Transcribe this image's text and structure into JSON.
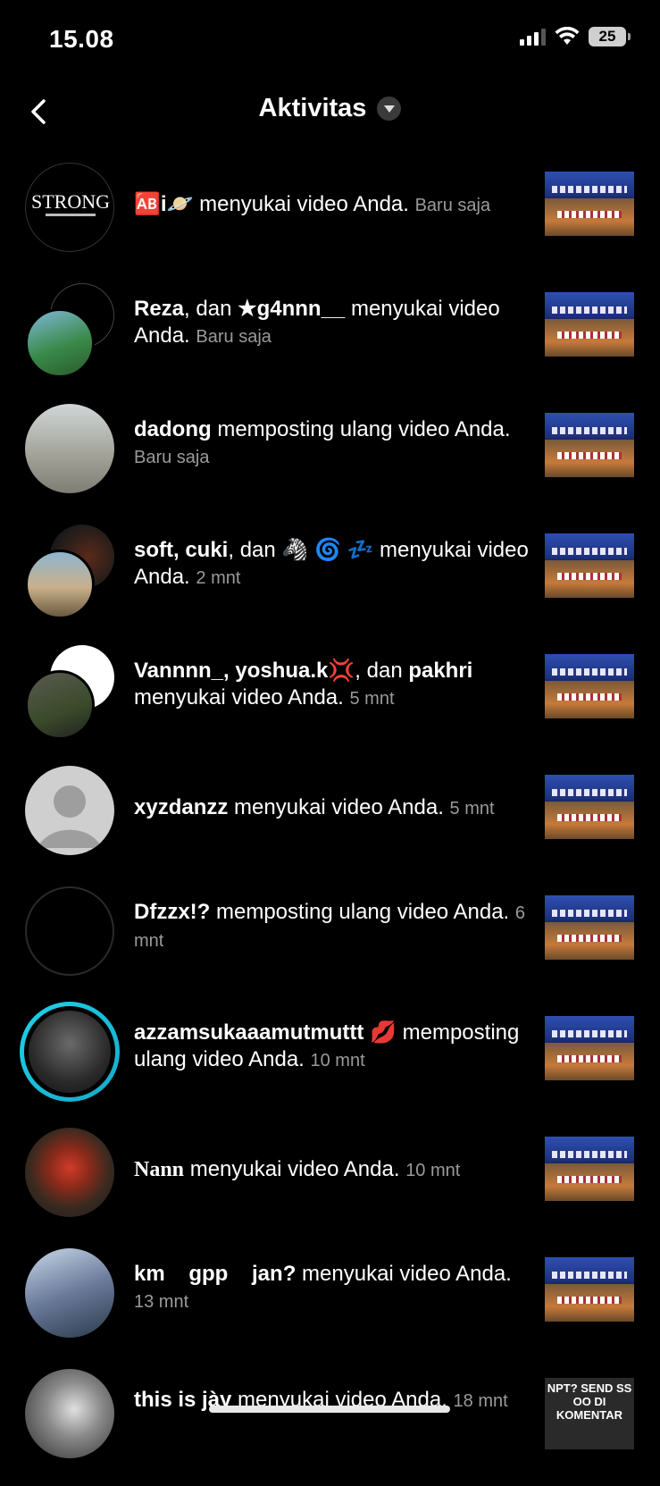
{
  "status_bar": {
    "time": "15.08",
    "battery": "25"
  },
  "header": {
    "title": "Aktivitas"
  },
  "items": [
    {
      "name": "🆎i🪐",
      "action": " menyukai video Anda. ",
      "time": "Baru saja"
    },
    {
      "name": "Reza",
      "action": ", dan ",
      "name2": "★g4nnn__",
      "action2": " menyukai video Anda. ",
      "time": "Baru saja"
    },
    {
      "name": "dadong",
      "action": " memposting ulang video Anda. ",
      "time": "Baru saja"
    },
    {
      "name": "soft, cuki",
      "action": ", dan 🦓 🌀 💤 menyukai video Anda. ",
      "time": "2 mnt"
    },
    {
      "name": "Vannnn_, yoshua.k💢",
      "action": ", dan ",
      "name2": "pakhri",
      "action2": " menyukai video Anda. ",
      "time": "5 mnt"
    },
    {
      "name": "xyzdanzz",
      "action": " menyukai video Anda. ",
      "time": "5 mnt"
    },
    {
      "name": "Dfzzx!?",
      "action": " memposting ulang video Anda. ",
      "time": "6 mnt"
    },
    {
      "name": "azzamsukaaamutmuttt 💋",
      "action": " memposting ulang video Anda. ",
      "time": "10 mnt"
    },
    {
      "name": "Nann",
      "action": " menyukai video Anda. ",
      "time": "10 mnt"
    },
    {
      "name": "km    gpp    jan?",
      "action": " menyukai video Anda. ",
      "time": "13 mnt"
    },
    {
      "name": "this is jày",
      "action": " menyukai video Anda. ",
      "time": "18 mnt",
      "thumb_caption": "NPT? SEND SS OO DI KOMENTAR"
    }
  ],
  "avatar_texts": {
    "strong_logo": "STRONG"
  }
}
